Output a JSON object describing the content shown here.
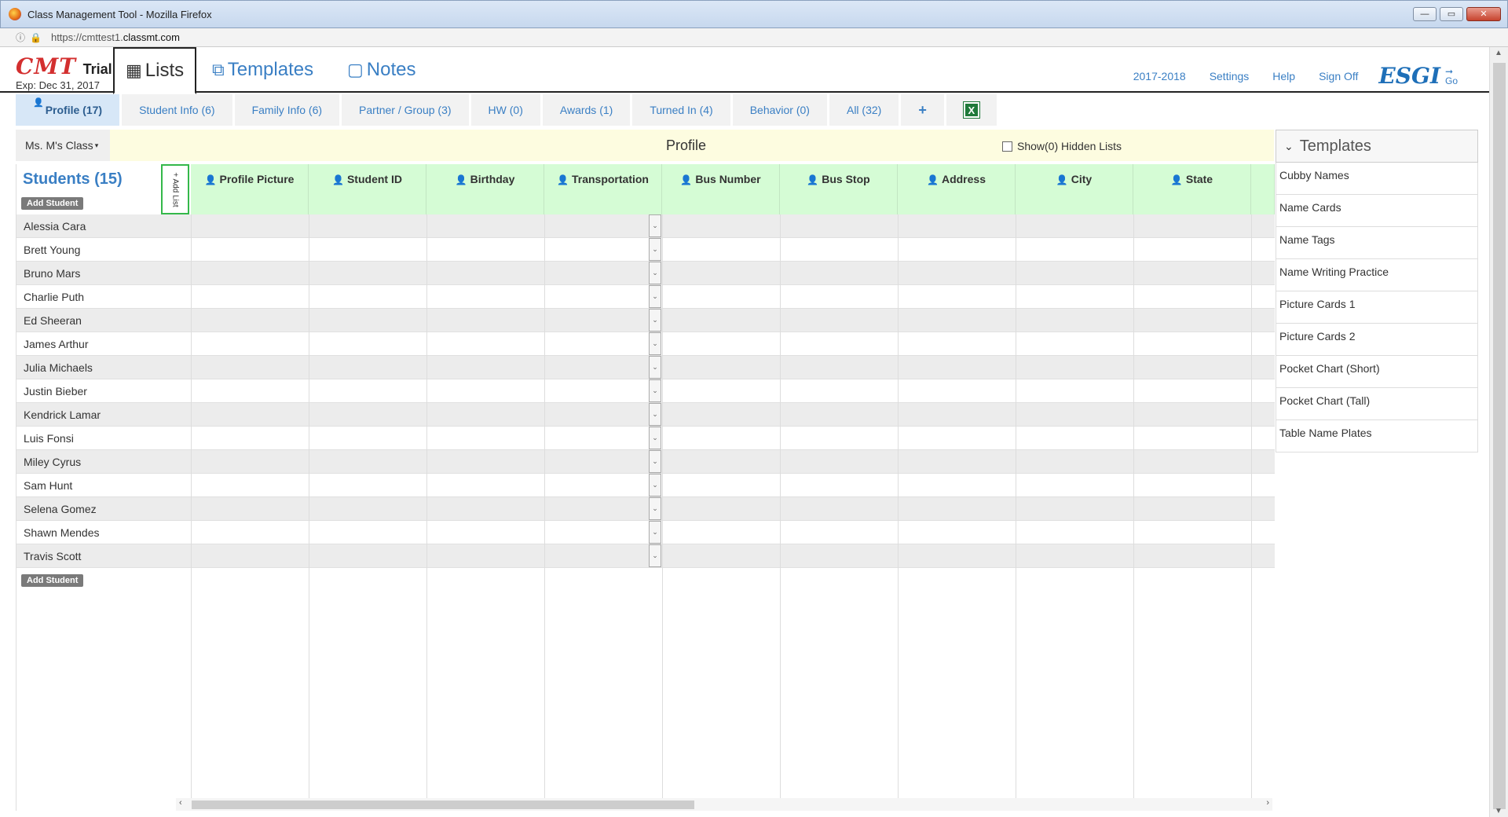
{
  "window": {
    "title": "Class Management Tool - Mozilla Firefox",
    "url_prefix": "https://cmttest1.",
    "url_domain": "classmt.com",
    "minimize": "—",
    "restore": "▭",
    "close": "✕"
  },
  "brand": {
    "logo": "CMT",
    "trial": "Trial",
    "expiry": "Exp: Dec 31, 2017"
  },
  "main_tabs": [
    {
      "label": "Lists",
      "icon": "table-icon"
    },
    {
      "label": "Templates",
      "icon": "template-icon"
    },
    {
      "label": "Notes",
      "icon": "note-icon"
    }
  ],
  "top_links": {
    "year": "2017-2018",
    "settings": "Settings",
    "help": "Help",
    "sign_off": "Sign Off",
    "esgi": "ESGI",
    "go": "Go"
  },
  "subtabs": [
    {
      "label": "Profile (17)"
    },
    {
      "label": "Student Info (6)"
    },
    {
      "label": "Family Info (6)"
    },
    {
      "label": "Partner / Group (3)"
    },
    {
      "label": "HW (0)"
    },
    {
      "label": "Awards (1)"
    },
    {
      "label": "Turned In (4)"
    },
    {
      "label": "Behavior (0)"
    },
    {
      "label": "All (32)"
    },
    {
      "label": "+"
    }
  ],
  "profile_bar": {
    "class_select": "Ms. M's Class",
    "title": "Profile",
    "hidden_lists": "Show(0) Hidden Lists"
  },
  "students": {
    "title": "Students (15)",
    "add_student": "Add Student",
    "add_list": "+ Add List",
    "names": [
      "Alessia Cara",
      "Brett Young",
      "Bruno Mars",
      "Charlie Puth",
      "Ed Sheeran",
      "James Arthur",
      "Julia Michaels",
      "Justin Bieber",
      "Kendrick Lamar",
      "Luis Fonsi",
      "Miley Cyrus",
      "Sam Hunt",
      "Selena Gomez",
      "Shawn Mendes",
      "Travis Scott"
    ]
  },
  "columns": [
    "Profile Picture",
    "Student ID",
    "Birthday",
    "Transportation",
    "Bus Number",
    "Bus Stop",
    "Address",
    "City",
    "State"
  ],
  "templates_panel": {
    "title": "Templates",
    "items": [
      "Cubby Names",
      "Name Cards",
      "Name Tags",
      "Name Writing Practice",
      "Picture Cards 1",
      "Picture Cards 2",
      "Pocket Chart (Short)",
      "Pocket Chart (Tall)",
      "Table Name Plates"
    ]
  }
}
